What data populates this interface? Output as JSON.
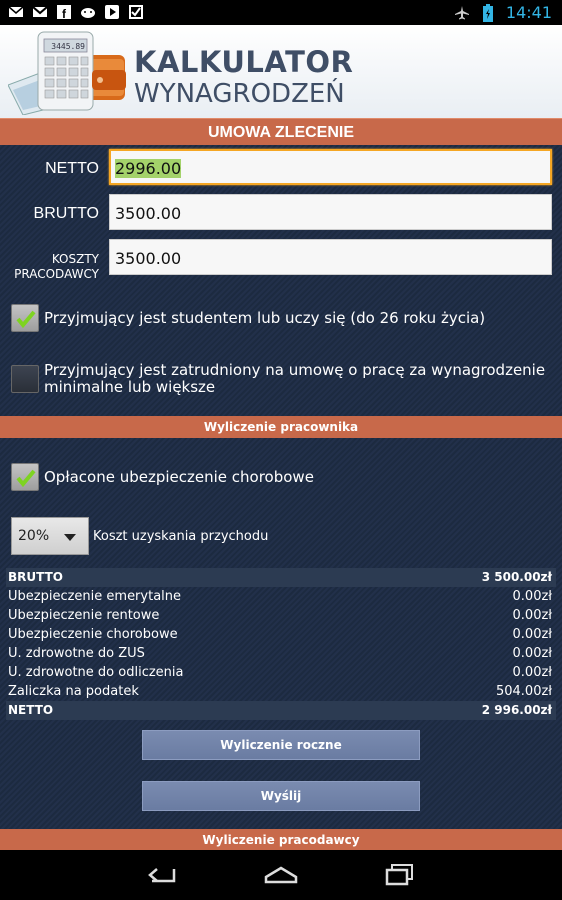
{
  "status_bar": {
    "time": "14:41",
    "left_icons": [
      "email-icon",
      "gmail-icon",
      "facebook-icon",
      "android-icon",
      "play-icon",
      "checkbox-icon"
    ],
    "right_icons": [
      "airplane-icon",
      "battery-icon"
    ]
  },
  "header": {
    "title_line1": "KALKULATOR",
    "title_line2": "WYNAGRODZEŃ",
    "logo_display": "3445.89"
  },
  "main_section": "UMOWA ZLECENIE",
  "fields": {
    "netto": {
      "label": "NETTO",
      "value": "2996.00"
    },
    "brutto": {
      "label": "BRUTTO",
      "value": "3500.00"
    },
    "koszty": {
      "label_line1": "KOSZTY",
      "label_line2": "PRACODAWCY",
      "value": "3500.00"
    }
  },
  "checkboxes": {
    "student": {
      "label": "Przyjmujący jest studentem lub uczy się (do 26 roku życia)",
      "checked": true
    },
    "employed": {
      "label_line1": "Przyjmujący jest zatrudniony na umowę o pracę za wynagrodzenie",
      "label_line2": "minimalne lub większe",
      "checked": false
    },
    "sickness": {
      "label": "Opłacone ubezpieczenie chorobowe",
      "checked": true
    }
  },
  "section_employee": "Wyliczenie pracownika",
  "cost_spinner": {
    "value": "20%",
    "label": "Koszt uzyskania przychodu"
  },
  "results": [
    {
      "name": "BRUTTO",
      "value": "3 500.00zł",
      "bold": true
    },
    {
      "name": "Ubezpieczenie emerytalne",
      "value": "0.00zł",
      "bold": false
    },
    {
      "name": "Ubezpieczenie rentowe",
      "value": "0.00zł",
      "bold": false
    },
    {
      "name": "Ubezpieczenie chorobowe",
      "value": "0.00zł",
      "bold": false
    },
    {
      "name": "U. zdrowotne do ZUS",
      "value": "0.00zł",
      "bold": false
    },
    {
      "name": "U. zdrowotne do odliczenia",
      "value": "0.00zł",
      "bold": false
    },
    {
      "name": "Zaliczka na podatek",
      "value": "504.00zł",
      "bold": false
    },
    {
      "name": "NETTO",
      "value": "2 996.00zł",
      "bold": true
    }
  ],
  "buttons": {
    "annual": "Wyliczenie roczne",
    "send": "Wyślij"
  },
  "section_employer": "Wyliczenie pracodawcy",
  "colors": {
    "section_bar": "#c8694a",
    "background": "#1f2c3f",
    "button": "#7080a8",
    "focus": "#f5a623",
    "time": "#33b5e5"
  }
}
